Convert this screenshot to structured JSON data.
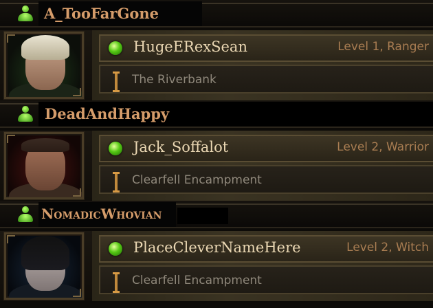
{
  "entries": [
    {
      "account_name": "A_TooFarGone",
      "character_name": "HugeERexSean",
      "character_info": "Level 1, Ranger",
      "location": "The Riverbank",
      "portrait": "ranger-portrait",
      "online_icon": "account-online-icon",
      "status_icon": "online-orb-icon",
      "location_icon": "location-bar-icon"
    },
    {
      "account_name": "DeadAndHappy",
      "character_name": "Jack_Soffalot",
      "character_info": "Level 2, Warrior",
      "location": "Clearfell Encampment",
      "portrait": "warrior-portrait",
      "online_icon": "account-online-icon",
      "status_icon": "online-orb-icon",
      "location_icon": "location-bar-icon"
    },
    {
      "account_name": "NomadicWhovian",
      "character_name": "PlaceCleverNameHere",
      "character_info": "Level 2, Witch",
      "location": "Clearfell Encampment",
      "portrait": "witch-portrait",
      "online_icon": "account-online-icon",
      "status_icon": "online-orb-icon",
      "location_icon": "location-bar-icon"
    }
  ],
  "colors": {
    "account_name": "#d59c6a",
    "character_name": "#ead7b3",
    "character_info": "#a97d52",
    "location": "#8f887b",
    "online": "#55c814"
  }
}
